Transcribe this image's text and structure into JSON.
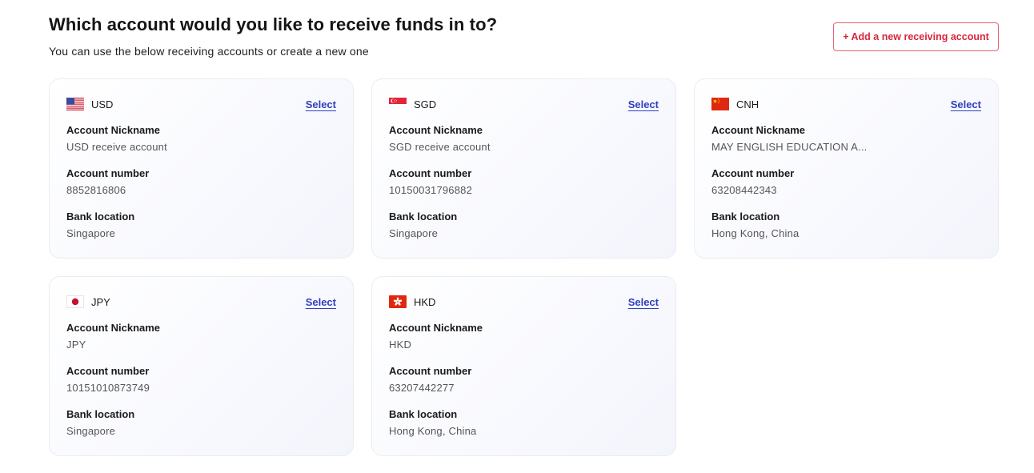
{
  "header": {
    "title": "Which account would you like to receive funds in to?",
    "subtitle": "You can use the below receiving accounts or create a new one",
    "add_button_label": "+ Add a new receiving account"
  },
  "labels": {
    "nickname": "Account Nickname",
    "number": "Account number",
    "location": "Bank location",
    "select": "Select"
  },
  "accounts": [
    {
      "currency": "USD",
      "flag": "us-flag-icon",
      "nickname": "USD receive account",
      "number": "8852816806",
      "location": "Singapore"
    },
    {
      "currency": "SGD",
      "flag": "sg-flag-icon",
      "nickname": "SGD receive account",
      "number": "10150031796882",
      "location": "Singapore"
    },
    {
      "currency": "CNH",
      "flag": "cn-flag-icon",
      "nickname": "MAY ENGLISH EDUCATION A...",
      "number": "63208442343",
      "location": "Hong Kong, China"
    },
    {
      "currency": "JPY",
      "flag": "jp-flag-icon",
      "nickname": "JPY",
      "number": "10151010873749",
      "location": "Singapore"
    },
    {
      "currency": "HKD",
      "flag": "hk-flag-icon",
      "nickname": "HKD",
      "number": "63207442277",
      "location": "Hong Kong, China"
    }
  ],
  "colors": {
    "accent_red": "#d7263d",
    "link_blue": "#2f3fbf"
  }
}
